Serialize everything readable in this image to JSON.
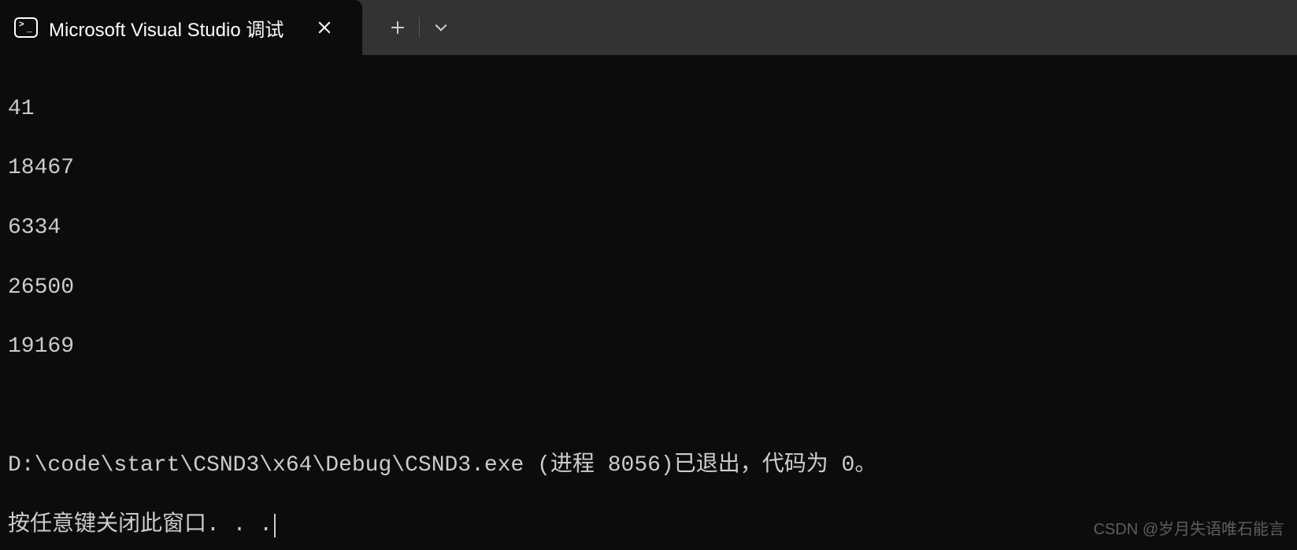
{
  "tab": {
    "title": "Microsoft Visual Studio 调试"
  },
  "output": {
    "lines": [
      "41",
      "18467",
      "6334",
      "26500",
      "19169"
    ],
    "exit_message": "D:\\code\\start\\CSND3\\x64\\Debug\\CSND3.exe (进程 8056)已退出，代码为 0。",
    "prompt": "按任意键关闭此窗口. . ."
  },
  "watermark": "CSDN @岁月失语唯石能言"
}
